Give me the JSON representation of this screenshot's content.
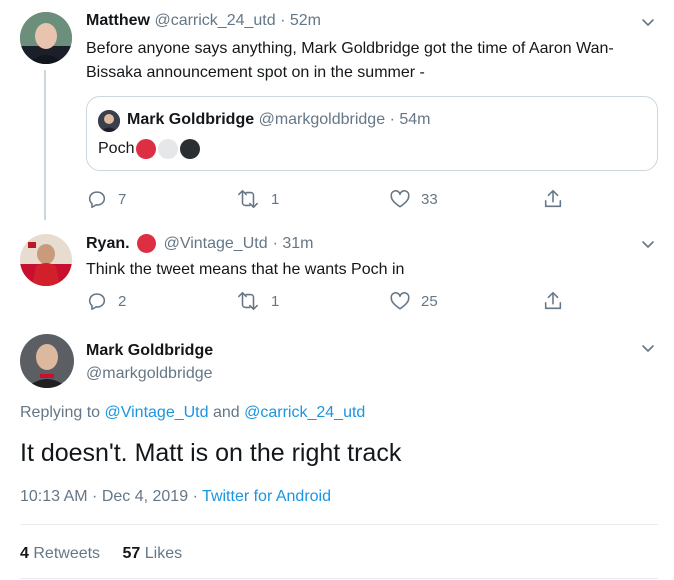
{
  "tweet1": {
    "name": "Matthew",
    "handle": "@carrick_24_utd",
    "time": "· 52m",
    "text": "Before anyone says anything, Mark Goldbridge got the time of Aaron Wan-Bissaka announcement spot on in the summer -",
    "quote": {
      "name": "Mark Goldbridge",
      "handle": "@markgoldbridge",
      "time": "· 54m",
      "text": "Poch",
      "dot_colors": [
        "#dd2e44",
        "#e6e7e8",
        "#292f33"
      ]
    },
    "replies": "7",
    "retweets": "1",
    "likes": "33"
  },
  "tweet2": {
    "name": "Ryan.",
    "badge_color": "#dd2e44",
    "handle": "@Vintage_Utd",
    "time": "· 31m",
    "text": "Think the tweet means that he wants Poch in",
    "replies": "2",
    "retweets": "1",
    "likes": "25"
  },
  "main": {
    "name": "Mark Goldbridge",
    "handle": "@markgoldbridge",
    "replying_label": "Replying to",
    "reply_to_1": "@Vintage_Utd",
    "reply_and": "and",
    "reply_to_2": "@carrick_24_utd",
    "text": "It doesn't. Matt is on the right track",
    "timestamp": "10:13 AM · Dec 4, 2019",
    "source": "Twitter for Android",
    "retweets_count": "4",
    "retweets_label": "Retweets",
    "likes_count": "57",
    "likes_label": "Likes"
  },
  "colors": {
    "link": "#1b95e0",
    "muted": "#657786",
    "accent_red": "#dd2e44"
  }
}
